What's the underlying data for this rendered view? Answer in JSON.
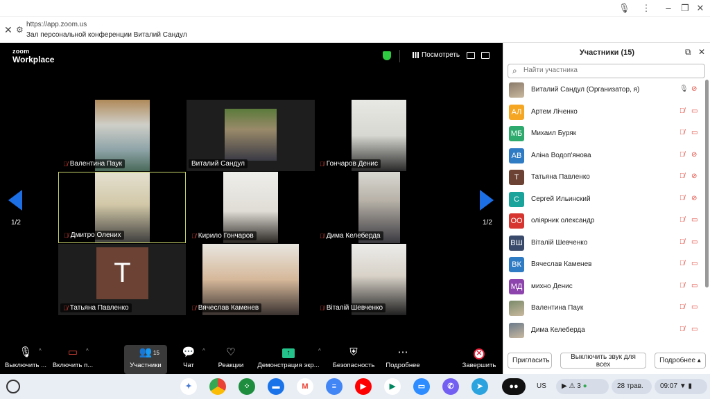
{
  "browser": {
    "url": "https://app.zoom.us",
    "title": "Зал персональной конференции Виталий Сандул"
  },
  "meeting": {
    "logo_top": "zoom",
    "logo_bottom": "Workplace",
    "view_label": "Посмотреть",
    "page_left": "1/2",
    "page_right": "1/2",
    "tiles": [
      {
        "name": "Валентина Паук",
        "muted": true
      },
      {
        "name": "Виталий Сандул",
        "muted": false
      },
      {
        "name": "Гончаров Денис",
        "muted": true
      },
      {
        "name": "Дмитро Олених",
        "muted": true
      },
      {
        "name": "Кирило Гончаров",
        "muted": true
      },
      {
        "name": "Дима Келеберда",
        "muted": true
      },
      {
        "name": "Татьяна Павленко",
        "muted": true,
        "avatar_letter": "T"
      },
      {
        "name": "Вячеслав Каменев",
        "muted": true
      },
      {
        "name": "Віталій Шевченко",
        "muted": true
      }
    ]
  },
  "toolbar": {
    "mute": "Выключить ...",
    "video": "Включить п...",
    "participants": "Участники",
    "participants_count": "15",
    "chat": "Чат",
    "reactions": "Реакции",
    "share": "Демонстрация экр...",
    "security": "Безопасность",
    "more": "Подробнее",
    "end": "Завершить"
  },
  "panel": {
    "title": "Участники (15)",
    "search_placeholder": "Найти участника",
    "participants": [
      {
        "name": "Виталий Сандул (Организатор, я)",
        "initials": "",
        "color": "#8a7a6a",
        "photo": true,
        "mic_muted": false,
        "cam_off": true
      },
      {
        "name": "Артем Ліченко",
        "initials": "АЛ",
        "color": "#f5a623",
        "mic_muted": true,
        "cam_off": false
      },
      {
        "name": "Михаил Буряк",
        "initials": "МБ",
        "color": "#2eaa6e",
        "mic_muted": true,
        "cam_off": false
      },
      {
        "name": "Аліна Водоп'янова",
        "initials": "АВ",
        "color": "#2f7bc4",
        "mic_muted": true,
        "cam_off": true
      },
      {
        "name": "Татьяна Павленко",
        "initials": "Т",
        "color": "#6b4234",
        "mic_muted": true,
        "cam_off": true
      },
      {
        "name": "Сергей Ильинский",
        "initials": "С",
        "color": "#1aa39a",
        "mic_muted": true,
        "cam_off": true
      },
      {
        "name": "оліярник олександр",
        "initials": "ОО",
        "color": "#d6362f",
        "mic_muted": true,
        "cam_off": false
      },
      {
        "name": "Віталій Шевченко",
        "initials": "ВШ",
        "color": "#3a4a6a",
        "mic_muted": true,
        "cam_off": false
      },
      {
        "name": "Вячеслав Каменев",
        "initials": "ВК",
        "color": "#2f7bc4",
        "mic_muted": true,
        "cam_off": false
      },
      {
        "name": "михно Денис",
        "initials": "МД",
        "color": "#8e44ad",
        "mic_muted": true,
        "cam_off": false
      },
      {
        "name": "Валентина Паук",
        "initials": "",
        "color": "#7a8a6a",
        "photo": true,
        "mic_muted": true,
        "cam_off": false
      },
      {
        "name": "Дима Келеберда",
        "initials": "",
        "color": "#6a7a8a",
        "photo": true,
        "mic_muted": true,
        "cam_off": false
      }
    ],
    "invite_label": "Пригласить",
    "mute_all_label": "Выключить звук для всех",
    "more_label": "Подробнее"
  },
  "shelf": {
    "lang": "US",
    "notif_count": "3",
    "date": "28 трав.",
    "time": "09:07"
  }
}
